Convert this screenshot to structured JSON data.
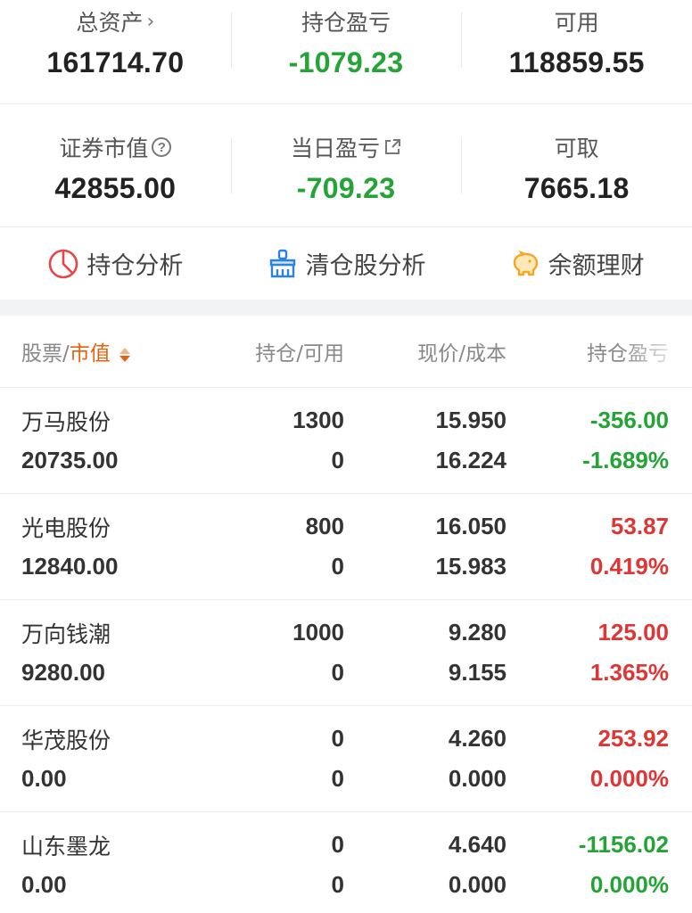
{
  "summary": {
    "total_assets": {
      "label": "总资产",
      "value": "161714.70"
    },
    "position_pl": {
      "label": "持仓盈亏",
      "value": "-1079.23"
    },
    "available": {
      "label": "可用",
      "value": "118859.55"
    },
    "market_value": {
      "label": "证券市值",
      "value": "42855.00"
    },
    "daily_pl": {
      "label": "当日盈亏",
      "value": "-709.23"
    },
    "withdrawable": {
      "label": "可取",
      "value": "7665.18"
    }
  },
  "tools": [
    {
      "label": "持仓分析",
      "icon": "pie-chart-icon",
      "color": "#e8454a"
    },
    {
      "label": "清仓股分析",
      "icon": "broom-icon",
      "color": "#2a82e4"
    },
    {
      "label": "余额理财",
      "icon": "piggy-bank-icon",
      "color": "#f5a623"
    }
  ],
  "table": {
    "headers": {
      "stock": "股票",
      "separator": "/",
      "market_value": "市值",
      "position": "持仓/可用",
      "price": "现价/成本",
      "pl": "持仓盈亏"
    },
    "rows": [
      {
        "name": "万马股份",
        "market_value": "20735.00",
        "position": "1300",
        "available": "0",
        "price": "15.950",
        "cost": "16.224",
        "pl": "-356.00",
        "pl_pct": "-1.689%",
        "tone": "green"
      },
      {
        "name": "光电股份",
        "market_value": "12840.00",
        "position": "800",
        "available": "0",
        "price": "16.050",
        "cost": "15.983",
        "pl": "53.87",
        "pl_pct": "0.419%",
        "tone": "red"
      },
      {
        "name": "万向钱潮",
        "market_value": "9280.00",
        "position": "1000",
        "available": "0",
        "price": "9.280",
        "cost": "9.155",
        "pl": "125.00",
        "pl_pct": "1.365%",
        "tone": "red"
      },
      {
        "name": "华茂股份",
        "market_value": "0.00",
        "position": "0",
        "available": "0",
        "price": "4.260",
        "cost": "0.000",
        "pl": "253.92",
        "pl_pct": "0.000%",
        "tone": "red"
      },
      {
        "name": "山东墨龙",
        "market_value": "0.00",
        "position": "0",
        "available": "0",
        "price": "4.640",
        "cost": "0.000",
        "pl": "-1156.02",
        "pl_pct": "0.000%",
        "tone": "green",
        "pl_pct_tone": "green"
      }
    ]
  },
  "colors": {
    "green": "#24a336",
    "red": "#e03535",
    "orange": "#e8610e"
  }
}
